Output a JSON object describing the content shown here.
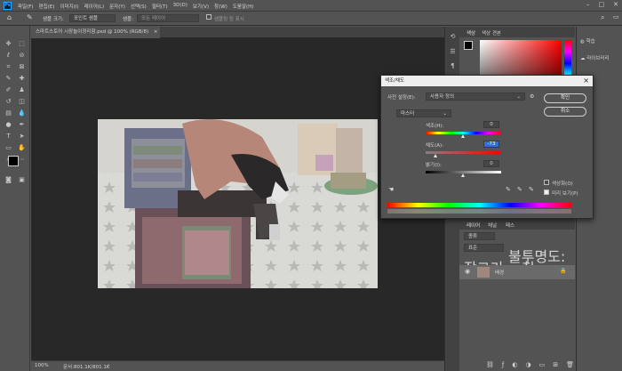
{
  "app": {
    "logo": "Ps",
    "accent": "#31a8ff"
  },
  "menu": [
    "파일(F)",
    "편집(E)",
    "이미지(I)",
    "레이어(L)",
    "문자(Y)",
    "선택(S)",
    "필터(T)",
    "3D(D)",
    "보기(V)",
    "창(W)",
    "도움말(H)"
  ],
  "window_controls": [
    "–",
    "□",
    "✕"
  ],
  "options": {
    "sample_size_label": "샘플 크기:",
    "sample_size_value": "포인트 샘플",
    "sample_label": "샘플:",
    "sample_value": "모든 레이어",
    "show_ring": "샘플링 링 표시"
  },
  "document": {
    "tab_title": "스마트스토어 시장놀이정리함.psd @ 100% (RGB/8)",
    "close": "×",
    "zoom": "100%",
    "doc_size": "문서:801.1K/801.1K"
  },
  "color_panel": {
    "tabs": [
      "색상",
      "색상 견본"
    ]
  },
  "right_panel": {
    "items": [
      "학습",
      "라이브러리"
    ]
  },
  "layers_panel": {
    "tabs": [
      "레이어",
      "채널",
      "패스"
    ],
    "kind": "종류",
    "blend": "표준",
    "opacity_label": "불투명도:",
    "fill_label": "칠:",
    "lock_label": "잠그기:",
    "layer_name": "배경"
  },
  "dialog": {
    "title": "색조/채도",
    "preset_label": "사전 설정(E):",
    "preset_value": "사용자 정의",
    "channel": "마스터",
    "hue_label": "색조(H):",
    "hue_value": 0,
    "sat_label": "채도(A):",
    "sat_value": "-73",
    "light_label": "밝기(I):",
    "light_value": 0,
    "colorize_label": "색상화(O)",
    "preview_label": "미리 보기(P)",
    "ok": "확인",
    "cancel": "취소"
  }
}
